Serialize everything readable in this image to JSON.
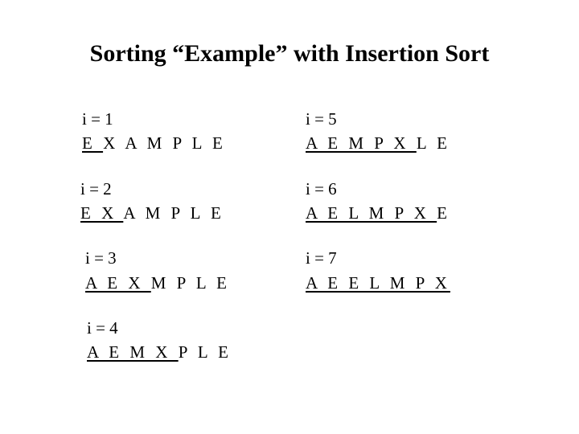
{
  "title": "Sorting “Example” with Insertion Sort",
  "left": [
    {
      "index": "i = 1",
      "sorted": "E ",
      "rest": "X A M P L E"
    },
    {
      "index": "i = 2",
      "sorted": "E X ",
      "rest": "A M P L E"
    },
    {
      "index": "i = 3",
      "sorted": "A E X ",
      "rest": "M P L E"
    },
    {
      "index": "i = 4",
      "sorted": "A E M X ",
      "rest": "P L E"
    }
  ],
  "right": [
    {
      "index": "i = 5",
      "sorted": "A E M P X  ",
      "rest": "L E"
    },
    {
      "index": "i = 6",
      "sorted": "A E L M P X ",
      "rest": "E"
    },
    {
      "index": "i = 7",
      "sorted": "A E E L M P X",
      "rest": ""
    }
  ]
}
